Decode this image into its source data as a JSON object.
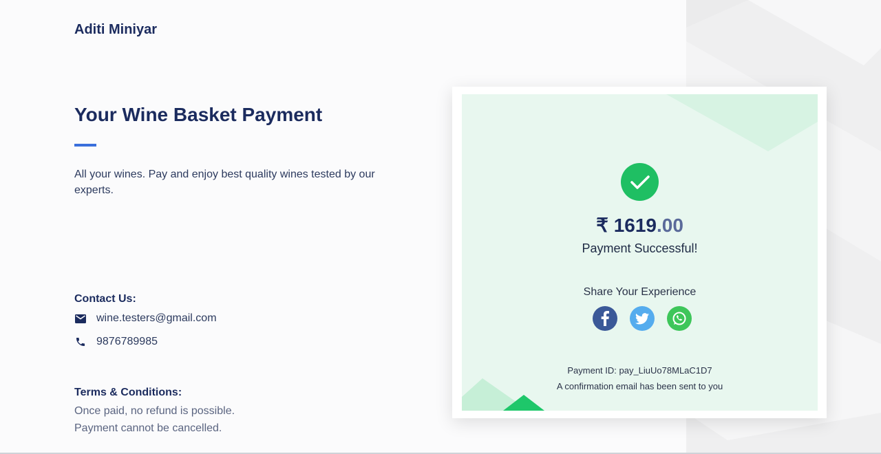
{
  "merchant": {
    "name": "Aditi Miniyar"
  },
  "payment_info": {
    "title": "Your Wine Basket Payment",
    "description": "All your wines. Pay and enjoy best quality wines tested by our experts."
  },
  "contact": {
    "heading": "Contact Us:",
    "email": "wine.testers@gmail.com",
    "phone": "9876789985"
  },
  "terms": {
    "heading": "Terms & Conditions:",
    "lines": [
      "Once paid,  no refund is possible.",
      "Payment cannot be cancelled."
    ]
  },
  "receipt": {
    "currency": "₹",
    "amount_whole": "1619",
    "amount_decimal": ".00",
    "status": "Payment Successful!",
    "share_label": "Share Your Experience",
    "share_icons": [
      "facebook-icon",
      "twitter-icon",
      "whatsapp-icon"
    ],
    "payment_id_label": "Payment ID: pay_LiuUo78MLaC1D7",
    "confirmation": "A confirmation email has been sent to you"
  },
  "colors": {
    "accent": "#3a6fdc",
    "success": "#1fbf63",
    "text_dark": "#1b2b5e",
    "card_bg": "#e8f7ef"
  }
}
